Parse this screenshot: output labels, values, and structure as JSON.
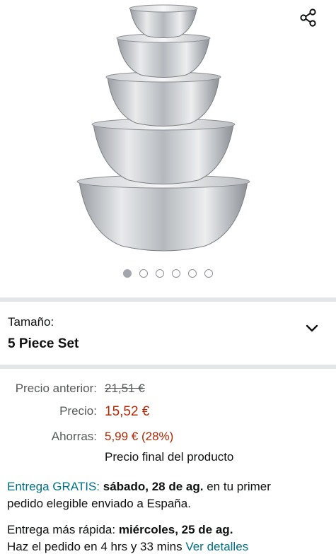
{
  "image_carousel": {
    "dot_count": 6,
    "active_index": 0
  },
  "size": {
    "label": "Tamaño:",
    "value": "5 Piece Set"
  },
  "pricing": {
    "previous_label": "Precio anterior:",
    "previous_value": "21,51 €",
    "price_label": "Precio:",
    "price_value": "15,52 €",
    "savings_label": "Ahorras:",
    "savings_value": "5,99 € (28%)",
    "final_note": "Precio final del producto"
  },
  "delivery": {
    "free_label": "Entrega GRATIS:",
    "free_date": "sábado, 28 de ag.",
    "free_suffix_1": "en tu primer",
    "free_suffix_2": "pedido elegible enviado a España.",
    "fastest_label": "Entrega más rápida:",
    "fastest_date": "miércoles, 25 de ag.",
    "order_within": "Haz el pedido en 4 hrs y 33 mins",
    "details_link": "Ver detalles"
  },
  "colors": {
    "price": "#b12704",
    "link": "#007185",
    "muted": "#565959"
  },
  "icons": [
    "share-icon",
    "chevron-down-icon"
  ]
}
